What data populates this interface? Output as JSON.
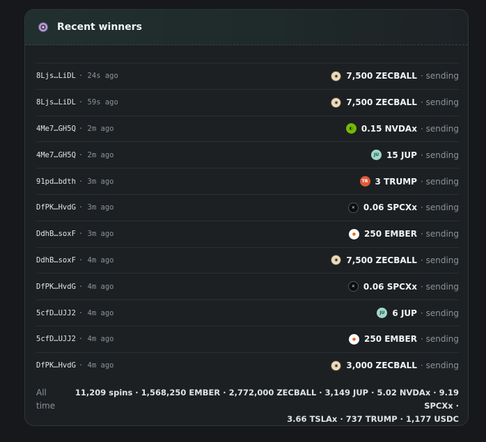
{
  "header": {
    "title": "Recent winners",
    "icon": "coin-logo-icon"
  },
  "rows": [
    {
      "address": "8Ljs…LiDL",
      "ago": "24s ago",
      "amount": "7,500 ZECBALL",
      "token": "zecball",
      "status": "sending"
    },
    {
      "address": "8Ljs…LiDL",
      "ago": "59s ago",
      "amount": "7,500 ZECBALL",
      "token": "zecball",
      "status": "sending"
    },
    {
      "address": "4Me7…GH5Q",
      "ago": "2m ago",
      "amount": "0.15 NVDAx",
      "token": "nvdax",
      "status": "sending"
    },
    {
      "address": "4Me7…GH5Q",
      "ago": "2m ago",
      "amount": "15 JUP",
      "token": "jup",
      "status": "sending"
    },
    {
      "address": "91pd…bdth",
      "ago": "3m ago",
      "amount": "3 TRUMP",
      "token": "trump",
      "status": "sending"
    },
    {
      "address": "DfPK…HvdG",
      "ago": "3m ago",
      "amount": "0.06 SPCXx",
      "token": "spcxx",
      "status": "sending"
    },
    {
      "address": "DdhB…soxF",
      "ago": "3m ago",
      "amount": "250 EMBER",
      "token": "ember",
      "status": "sending"
    },
    {
      "address": "DdhB…soxF",
      "ago": "4m ago",
      "amount": "7,500 ZECBALL",
      "token": "zecball",
      "status": "sending"
    },
    {
      "address": "DfPK…HvdG",
      "ago": "4m ago",
      "amount": "0.06 SPCXx",
      "token": "spcxx",
      "status": "sending"
    },
    {
      "address": "5cfD…UJJ2",
      "ago": "4m ago",
      "amount": "6 JUP",
      "token": "jup",
      "status": "sending"
    },
    {
      "address": "5cfD…UJJ2",
      "ago": "4m ago",
      "amount": "250 EMBER",
      "token": "ember",
      "status": "sending"
    },
    {
      "address": "DfPK…HvdG",
      "ago": "4m ago",
      "amount": "3,000 ZECBALL",
      "token": "zecball",
      "status": "sending"
    }
  ],
  "footer": {
    "label": "All time",
    "totals_line1": "11,209 spins · 1,568,250 EMBER · 2,772,000 ZECBALL · 3,149 JUP · 5.02 NVDAx · 9.19 SPCXx ·",
    "totals_line2": "3.66 TSLAx · 737 TRUMP · 1,177 USDC"
  },
  "token_styles": {
    "zecball": {
      "bg": "#e9dcc0",
      "fg": "#3a2e12",
      "glyph": "◉",
      "border": "#5a4a2a"
    },
    "nvdax": {
      "bg": "#76b900",
      "fg": "#1a2a05",
      "glyph": "◐",
      "border": "#76b900"
    },
    "jup": {
      "bg": "#9fd8c9",
      "fg": "#1b4d45",
      "glyph": "JU",
      "border": "#9fd8c9"
    },
    "trump": {
      "bg": "#e05a3a",
      "fg": "#ffffff",
      "glyph": "TR",
      "border": "#e05a3a"
    },
    "spcxx": {
      "bg": "#0d0d0d",
      "fg": "#e6e6e6",
      "glyph": "✕",
      "border": "#555555"
    },
    "ember": {
      "bg": "#ffffff",
      "fg": "#f06a1d",
      "glyph": "●",
      "border": "#ffffff"
    }
  }
}
